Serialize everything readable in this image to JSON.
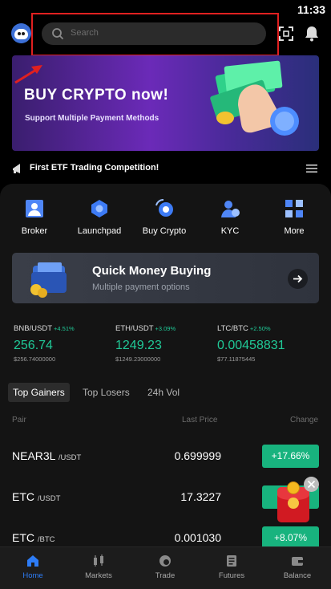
{
  "status_bar": {
    "time": "11:33"
  },
  "header": {
    "search_placeholder": "Search",
    "icons": [
      "avatar",
      "scan-icon",
      "bell-icon"
    ]
  },
  "banner": {
    "title": "BUY CRYPTO now!",
    "subtitle": "Support Multiple Payment Methods"
  },
  "announcement": {
    "text": "First ETF Trading Competition!"
  },
  "quick_actions": [
    {
      "label": "Broker",
      "icon": "broker-icon"
    },
    {
      "label": "Launchpad",
      "icon": "launchpad-icon"
    },
    {
      "label": "Buy Crypto",
      "icon": "buy-crypto-icon"
    },
    {
      "label": "KYC",
      "icon": "kyc-icon"
    },
    {
      "label": "More",
      "icon": "more-icon"
    }
  ],
  "promo": {
    "title": "Quick Money Buying",
    "subtitle": "Multiple payment options"
  },
  "tickers": [
    {
      "pair": "BNB/USDT",
      "change": "+4.51%",
      "price": "256.74",
      "fiat": "$256.74000000"
    },
    {
      "pair": "ETH/USDT",
      "change": "+3.09%",
      "price": "1249.23",
      "fiat": "$1249.23000000"
    },
    {
      "pair": "LTC/BTC",
      "change": "+2.50%",
      "price": "0.00458831",
      "fiat": "$77.11875445"
    }
  ],
  "market_tabs": [
    {
      "label": "Top Gainers",
      "active": true
    },
    {
      "label": "Top Losers",
      "active": false
    },
    {
      "label": "24h Vol",
      "active": false
    }
  ],
  "table": {
    "headers": {
      "pair": "Pair",
      "last_price": "Last Price",
      "change": "Change"
    },
    "rows": [
      {
        "base": "NEAR3L",
        "quote": "/USDT",
        "last_price": "0.699999",
        "change": "+17.66%"
      },
      {
        "base": "ETC",
        "quote": "/USDT",
        "last_price": "17.3227",
        "change": "+"
      },
      {
        "base": "ETC",
        "quote": "/BTC",
        "last_price": "0.001030",
        "change": "+8.07%"
      }
    ]
  },
  "bottom_nav": [
    {
      "label": "Home",
      "active": true,
      "icon": "home-icon"
    },
    {
      "label": "Markets",
      "active": false,
      "icon": "markets-icon"
    },
    {
      "label": "Trade",
      "active": false,
      "icon": "trade-icon"
    },
    {
      "label": "Futures",
      "active": false,
      "icon": "futures-icon"
    },
    {
      "label": "Balance",
      "active": false,
      "icon": "balance-icon"
    }
  ],
  "colors": {
    "accent_blue": "#2d7cf6",
    "positive_green": "#18b37e",
    "highlight_red": "#e02020",
    "background": "#000000",
    "panel": "#141414"
  }
}
